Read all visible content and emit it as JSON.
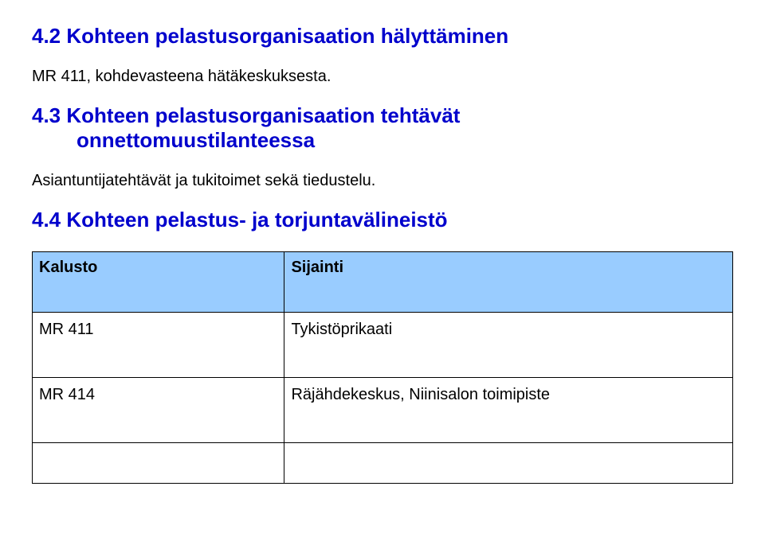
{
  "section_4_2": {
    "heading": "4.2 Kohteen pelastusorganisaation hälyttäminen",
    "body": "MR 411, kohdevasteena hätäkeskuksesta."
  },
  "section_4_3": {
    "heading_line1": "4.3 Kohteen pelastusorganisaation tehtävät",
    "heading_line2": "onnettomuustilanteessa",
    "body": "Asiantuntijatehtävät ja tukitoimet sekä tiedustelu."
  },
  "section_4_4": {
    "heading": "4.4 Kohteen pelastus- ja torjuntavälineistö",
    "table": {
      "headers": {
        "col1": "Kalusto",
        "col2": "Sijainti"
      },
      "rows": [
        {
          "col1": "MR 411",
          "col2": "Tykistöprikaati"
        },
        {
          "col1": "MR 414",
          "col2": "Räjähdekeskus, Niinisalon toimipiste"
        },
        {
          "col1": "",
          "col2": ""
        }
      ]
    }
  }
}
